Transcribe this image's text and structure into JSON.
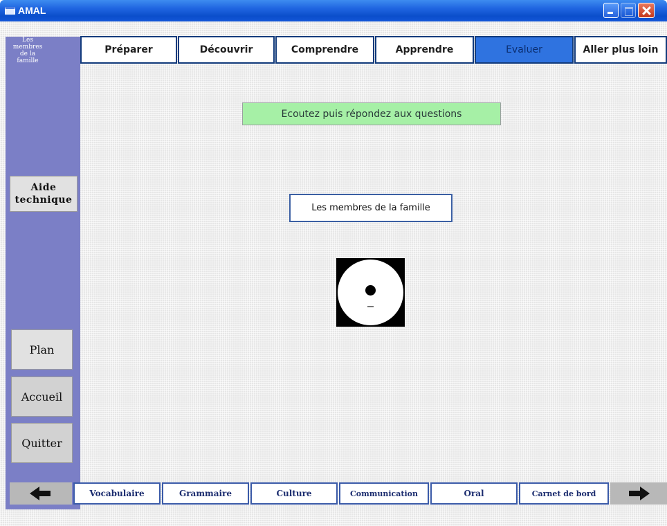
{
  "window": {
    "title": "AMAL"
  },
  "sidebar": {
    "title_lines": [
      "Les",
      "membres",
      "de la",
      "famille"
    ],
    "aide_label_1": "Aide",
    "aide_label_2": "technique",
    "plan_label": "Plan",
    "accueil_label": "Accueil",
    "quitter_label": "Quitter"
  },
  "tabs": [
    {
      "label": "Préparer"
    },
    {
      "label": "Découvrir"
    },
    {
      "label": "Comprendre"
    },
    {
      "label": "Apprendre"
    },
    {
      "label": "Evaluer",
      "active": true
    },
    {
      "label": "Aller plus loin"
    }
  ],
  "main": {
    "instruction": "Ecoutez puis répondez aux questions",
    "topic_button": "Les membres de la famille",
    "audio_icon": "cd-icon"
  },
  "bottom_nav": [
    {
      "label": "Vocabulaire"
    },
    {
      "label": "Grammaire"
    },
    {
      "label": "Culture"
    },
    {
      "label": "Communication"
    },
    {
      "label": "Oral"
    },
    {
      "label": "Carnet de bord"
    }
  ],
  "colors": {
    "titlebar": "#1f64e0",
    "sidebar": "#7b7fc6",
    "active_tab": "#2f73e0",
    "instruction_bg": "#a6f0a6"
  }
}
